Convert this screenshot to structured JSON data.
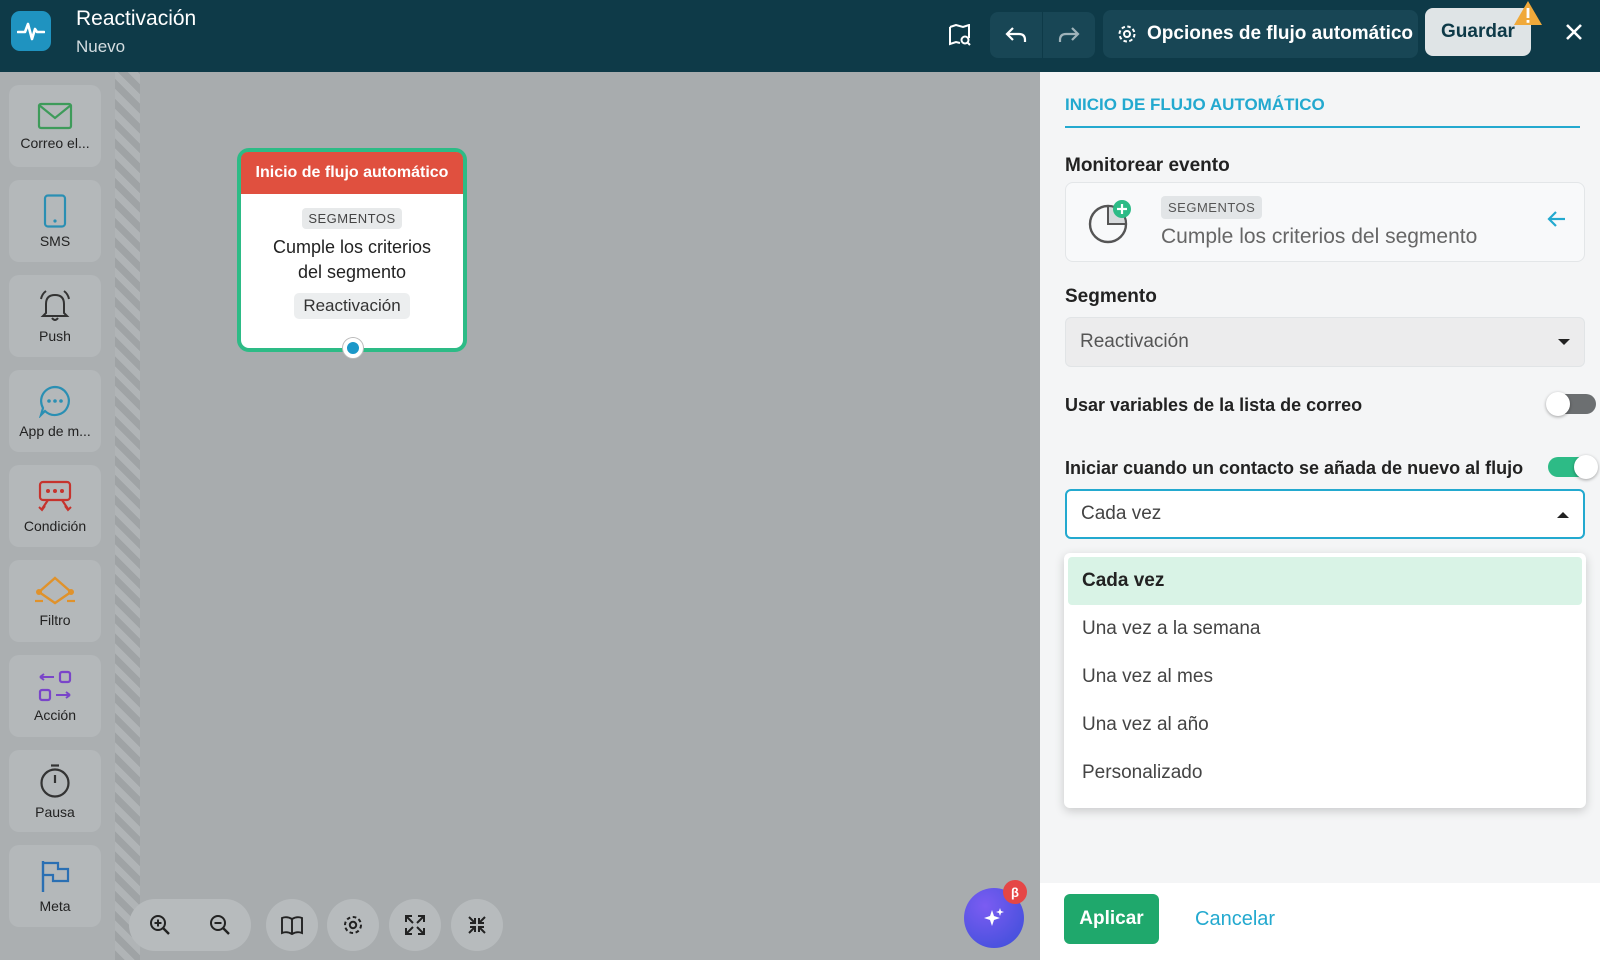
{
  "header": {
    "title": "Reactivación",
    "subtitle": "Nuevo",
    "options_label": "Opciones de flujo automático",
    "save_label": "Guardar"
  },
  "toolbar": {
    "items": [
      {
        "label": "Correo el...",
        "icon": "mail-icon"
      },
      {
        "label": "SMS",
        "icon": "phone-icon"
      },
      {
        "label": "Push",
        "icon": "bell-icon"
      },
      {
        "label": "App de m...",
        "icon": "chat-icon"
      },
      {
        "label": "Condición",
        "icon": "condition-icon"
      },
      {
        "label": "Filtro",
        "icon": "filter-icon"
      },
      {
        "label": "Acción",
        "icon": "action-icon"
      },
      {
        "label": "Pausa",
        "icon": "clock-icon"
      },
      {
        "label": "Meta",
        "icon": "flag-icon"
      }
    ]
  },
  "node": {
    "header": "Inicio de flujo automático",
    "tag": "SEGMENTOS",
    "text_line1": "Cumple los criterios",
    "text_line2": "del segmento",
    "pill": "Reactivación"
  },
  "ai": {
    "badge": "β"
  },
  "panel": {
    "title": "INICIO DE FLUJO AUTOMÁTICO",
    "monitor_label": "Monitorear evento",
    "event_tag": "SEGMENTOS",
    "event_text": "Cumple los criterios del segmento",
    "segment_label": "Segmento",
    "segment_value": "Reactivación",
    "use_vars_label": "Usar variables de la lista de correo",
    "use_vars_on": false,
    "restart_label": "Iniciar cuando un contacto se añada de nuevo al flujo",
    "restart_on": true,
    "frequency_value": "Cada vez",
    "frequency_options": [
      "Cada vez",
      "Una vez a la semana",
      "Una vez al mes",
      "Una vez al año",
      "Personalizado"
    ],
    "apply_label": "Aplicar",
    "cancel_label": "Cancelar"
  },
  "colors": {
    "topbar": "#0e3a48",
    "accent": "#23a9cf",
    "success": "#1fa86c",
    "node_header": "#e0503f"
  }
}
